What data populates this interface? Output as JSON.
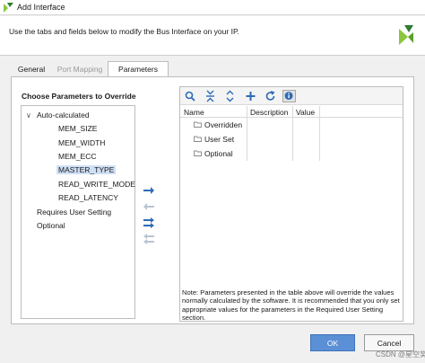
{
  "window": {
    "title": "Add Interface",
    "app_icon": "vivado-logo-icon"
  },
  "header": {
    "description": "Use the tabs and fields below to modify the Bus Interface on your IP.",
    "logo": "vivado-logo-icon"
  },
  "tabs": [
    {
      "label": "General",
      "state": "normal"
    },
    {
      "label": "Port Mapping",
      "state": "disabled"
    },
    {
      "label": "Parameters",
      "state": "active"
    }
  ],
  "left_panel": {
    "label": "Choose Parameters to Override",
    "tree": {
      "root": "Auto-calculated",
      "children": [
        "MEM_SIZE",
        "MEM_WIDTH",
        "MEM_ECC",
        "MASTER_TYPE",
        "READ_WRITE_MODE",
        "READ_LATENCY"
      ],
      "selected": "MASTER_TYPE",
      "others": [
        "Requires User Setting",
        "Optional"
      ]
    }
  },
  "move_buttons": [
    {
      "icon": "arrow-right-icon",
      "enabled": true
    },
    {
      "icon": "arrow-left-icon",
      "enabled": false
    },
    {
      "icon": "arrow-right-all-icon",
      "enabled": true
    },
    {
      "icon": "arrow-left-all-icon",
      "enabled": false
    }
  ],
  "param_toolbar": [
    "search-icon",
    "collapse-all-icon",
    "expand-all-icon",
    "add-icon",
    "refresh-icon",
    "info-icon"
  ],
  "param_table": {
    "columns": [
      "Name",
      "Description",
      "Value"
    ],
    "rows": [
      "Overridden",
      "User Set",
      "Optional"
    ]
  },
  "note": "Note: Parameters presented in the table above will override the values normally calculated by the software. It is recommended that you only set appropriate values for the parameters in the Required User Setting section.",
  "buttons": {
    "ok": "OK",
    "cancel": "Cancel"
  },
  "watermark": "CSDN @星空奖",
  "colors": {
    "accent": "#5b8fd6",
    "selection": "#cfe0f5",
    "logo_green": "#8cc63e",
    "icon_blue": "#2d6cb5"
  }
}
